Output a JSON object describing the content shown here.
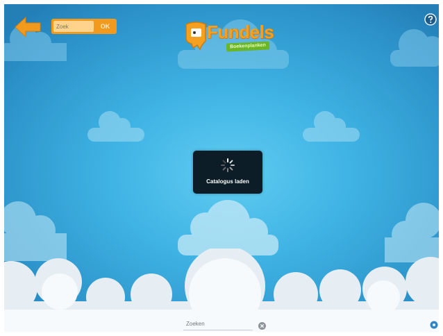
{
  "header": {
    "back_icon": "arrow-left-icon",
    "search": {
      "value": "",
      "placeholder": "Zoek"
    },
    "ok_label": "OK",
    "logo": {
      "name": "Fundels",
      "tagline": "Boekenplanken"
    },
    "help_icon": "help-icon"
  },
  "loading": {
    "text": "Catalogus laden",
    "spinner_icon": "spinner-icon"
  },
  "footer": {
    "search": {
      "value": "",
      "placeholder": "Zoeken"
    },
    "clear_icon": "clear-icon",
    "settings_icon": "gear-icon"
  },
  "colors": {
    "sky_center": "#5fcdf2",
    "sky_edge": "#247fb7",
    "brand_orange": "#f29a1d",
    "brand_green": "#6bb52b",
    "dialog_bg": "#0c1d28"
  }
}
